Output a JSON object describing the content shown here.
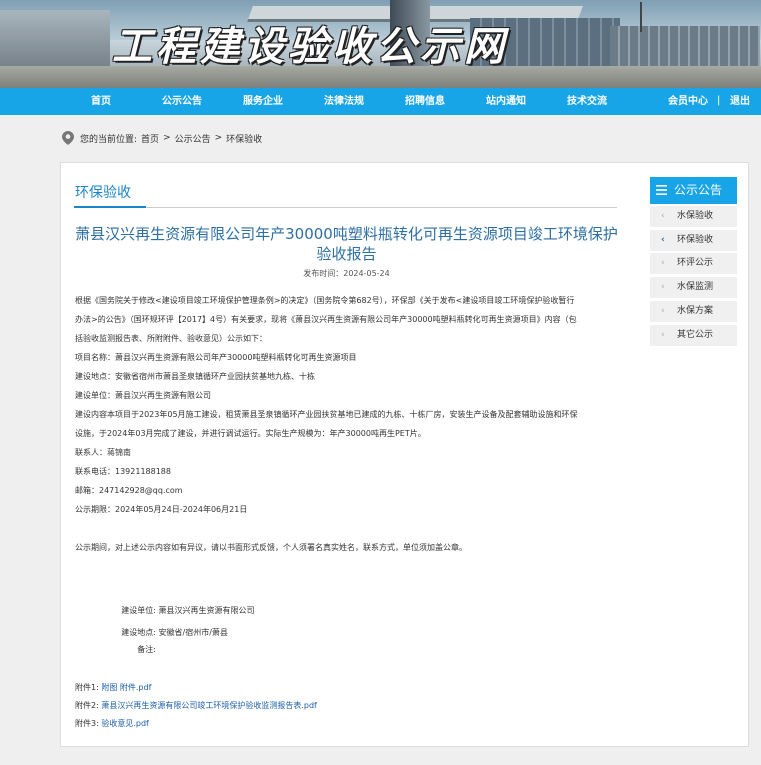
{
  "site": {
    "banner_title": "工程建设验收公示网"
  },
  "nav": {
    "items": [
      "首页",
      "公示公告",
      "服务企业",
      "法律法规",
      "招聘信息",
      "站内通知",
      "技术交流"
    ],
    "member": "会员中心",
    "separator": "|",
    "logout": "退出"
  },
  "breadcrumb": {
    "prefix": "您的当前位置:",
    "items": [
      "首页",
      ">",
      "公示公告",
      ">",
      "环保验收"
    ]
  },
  "section": {
    "title": "环保验收"
  },
  "article": {
    "title": "萧县汉兴再生资源有限公司年产30000吨塑料瓶转化可再生资源项目竣工环境保护验收报告",
    "date": "发布时间：2024-05-24",
    "paragraphs": [
      "根据《国务院关于修改<建设项目竣工环境保护管理条例>的决定》（国务院令第682号），环保部《关于发布<建设项目竣工环境保护验收暂行",
      "办法>的公告》（国环规环评【2017】4号）有关要求，现将《萧县汉兴再生资源有限公司年产30000吨塑料瓶转化可再生资源项目》内容（包",
      "括验收监测报告表、所附附件、验收意见）公示如下：",
      "项目名称：萧县汉兴再生资源有限公司年产30000吨塑料瓶转化可再生资源项目",
      "建设地点：安徽省宿州市萧县圣泉镇循环产业园扶贫基地九栋、十栋",
      "建设单位：萧县汉兴再生资源有限公司",
      "建设内容本项目于2023年05月施工建设，租赁萧县圣泉镇循环产业园扶贫基地已建成的九栋、十栋厂房，安装生产设备及配套辅助设施和环保",
      "设施，于2024年03月完成了建设，并进行调试运行。实际生产规模为：年产30000吨再生PET片。",
      "联系人：蒋锦南",
      "联系电话：13921188188",
      "邮箱：247142928@qq.com",
      "公示期限：2024年05月24日-2024年06月21日",
      "",
      "公示期间，对上述公示内容如有异议，请以书面形式反馈，个人须署名真实姓名，联系方式，单位须加盖公章。"
    ],
    "signature": [
      {
        "label": "建设单位:",
        "value": "萧县汉兴再生资源有限公司"
      },
      {
        "label": "建设地点:",
        "value": "安徽省/宿州市/萧县"
      },
      {
        "label": "备注:",
        "value": ""
      }
    ],
    "attachments": [
      {
        "label": "附件1:",
        "link": "附图 附件.pdf"
      },
      {
        "label": "附件2:",
        "link": "萧县汉兴再生资源有限公司竣工环境保护验收监测报告表.pdf"
      },
      {
        "label": "附件3:",
        "link": "验收意见.pdf"
      }
    ]
  },
  "sidebar": {
    "header": "公示公告",
    "items": [
      "水保验收",
      "环保验收",
      "环评公示",
      "水保监测",
      "水保方案",
      "其它公示"
    ],
    "active_index": 1
  },
  "colors": {
    "nav_bg": "#18a5e8",
    "link": "#1a5ea8",
    "title": "#2e6fa3"
  }
}
